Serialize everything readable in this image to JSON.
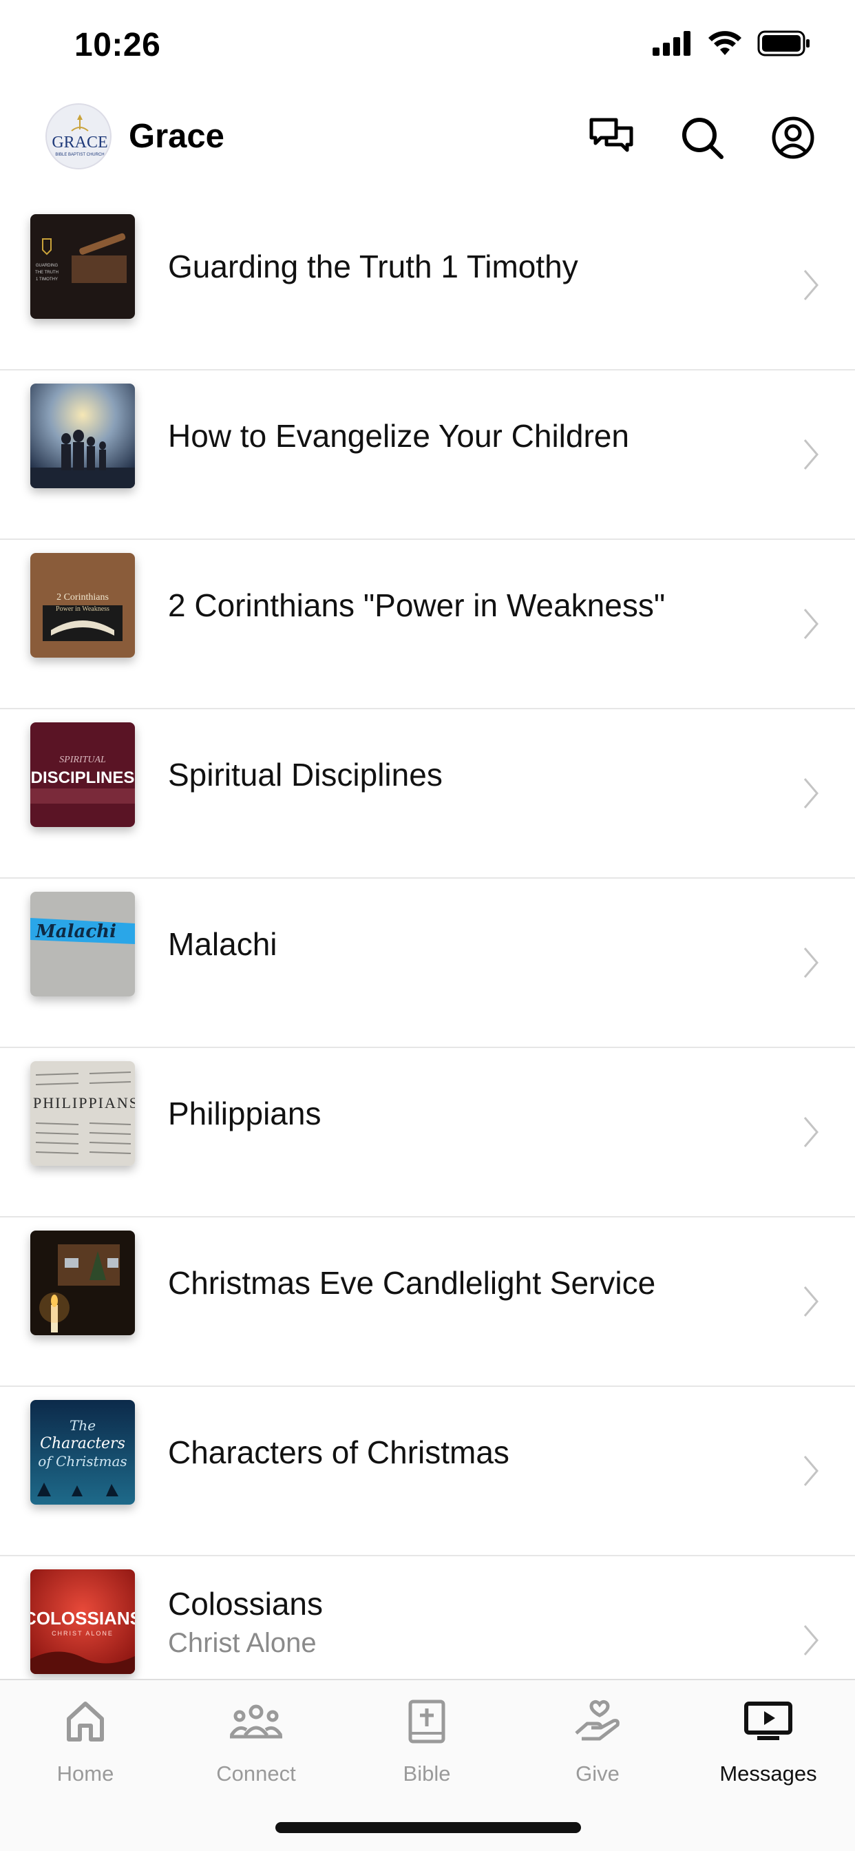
{
  "status_bar": {
    "time": "10:26"
  },
  "header": {
    "church_name": "Grace",
    "avatar_text": "GRACE",
    "avatar_subtext": "BIBLE BAPTIST CHURCH"
  },
  "series": [
    {
      "title": "Guarding the Truth 1 Timothy",
      "subtitle": "",
      "thumb_text": "GUARDING THE TRUTH 1 TIMOTHY"
    },
    {
      "title": "How to Evangelize Your Children",
      "subtitle": "",
      "thumb_text": ""
    },
    {
      "title": "2 Corinthians \"Power in Weakness\"",
      "subtitle": "",
      "thumb_text": "2 Corinthians",
      "thumb_text2": "Power in Weakness"
    },
    {
      "title": "Spiritual Disciplines",
      "subtitle": "",
      "thumb_text": "SPIRITUAL",
      "thumb_text2": "DISCIPLINES"
    },
    {
      "title": "Malachi",
      "subtitle": "",
      "thumb_text": "Malachi"
    },
    {
      "title": "Philippians",
      "subtitle": "",
      "thumb_text": "PHILIPPIANS"
    },
    {
      "title": "Christmas Eve Candlelight Service",
      "subtitle": "",
      "thumb_text": ""
    },
    {
      "title": "Characters of Christmas",
      "subtitle": "",
      "thumb_text": "The Characters of Christmas"
    },
    {
      "title": "Colossians",
      "subtitle": "Christ Alone",
      "thumb_text": "COLOSSIANS",
      "thumb_text2": "CHRIST ALONE"
    }
  ],
  "tabs": [
    {
      "label": "Home",
      "icon": "home-icon",
      "active": false
    },
    {
      "label": "Connect",
      "icon": "people-icon",
      "active": false
    },
    {
      "label": "Bible",
      "icon": "bible-icon",
      "active": false
    },
    {
      "label": "Give",
      "icon": "give-icon",
      "active": false
    },
    {
      "label": "Messages",
      "icon": "play-screen-icon",
      "active": true
    }
  ],
  "colors": {
    "tab_inactive": "#9a9a9a",
    "tab_active": "#111111",
    "divider": "#e6e6e6",
    "chevron": "#c4c4c4"
  }
}
